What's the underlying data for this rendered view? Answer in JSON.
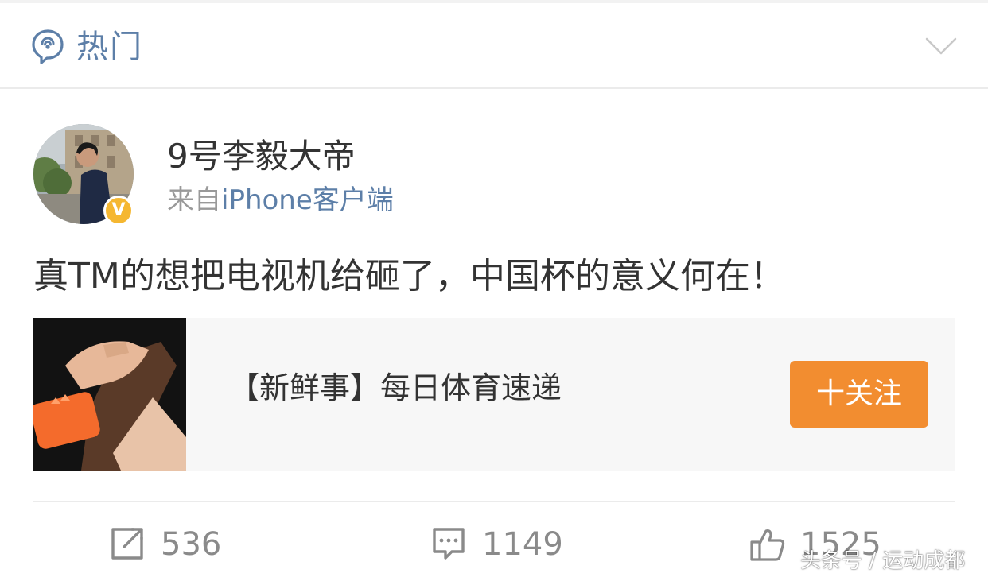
{
  "header": {
    "title": "热门",
    "icon": "hot-topic-icon",
    "collapse_icon": "chevron-down-icon",
    "accent_color": "#5d7fa8"
  },
  "post": {
    "username": "9号李毅大帝",
    "source_prefix": "来自",
    "source_app": "iPhone客户端",
    "verified_badge": "V",
    "text": "真TM的想把电视机给砸了，中国杯的意义何在！"
  },
  "card": {
    "title": "【新鲜事】每日体育速递",
    "follow_label": "十关注",
    "follow_color": "#f28d30"
  },
  "actions": {
    "repost_count": "536",
    "comment_count": "1149",
    "like_count": "1525"
  },
  "watermark": "头条号 / 运动成都"
}
